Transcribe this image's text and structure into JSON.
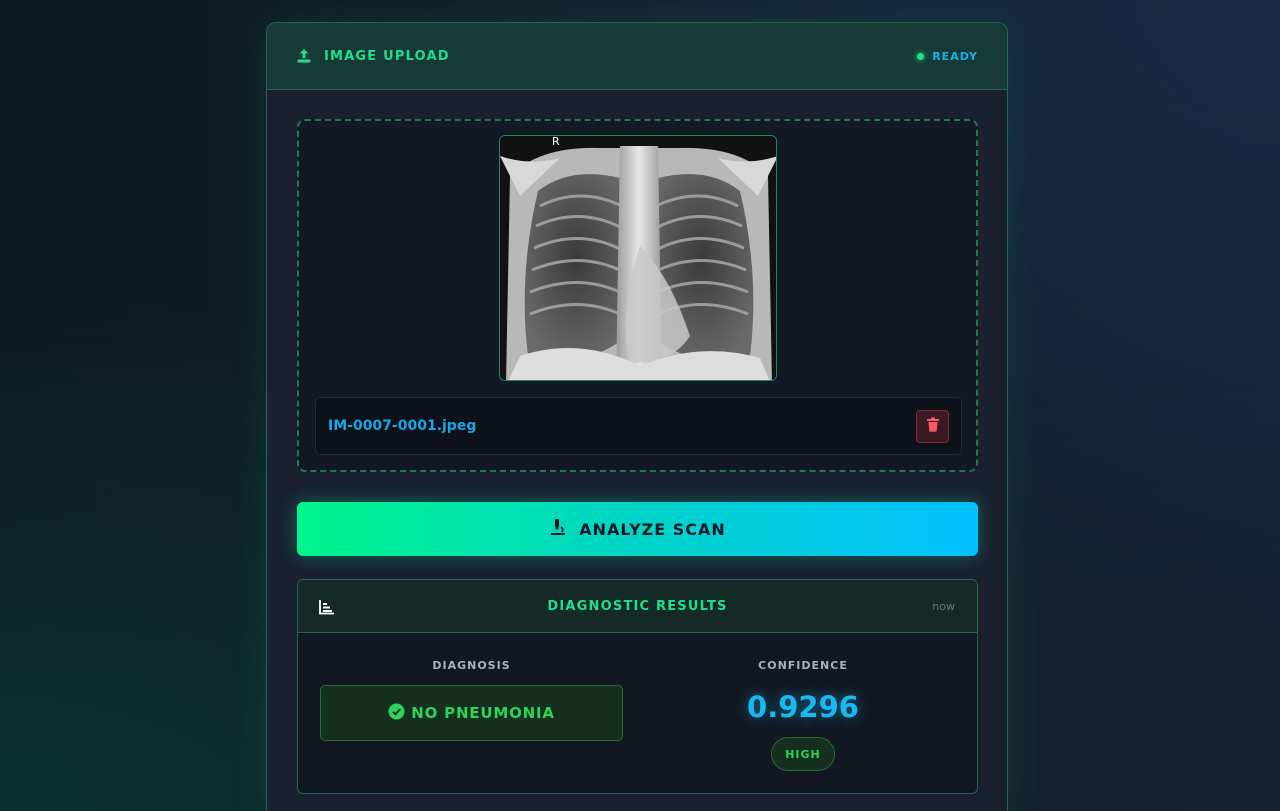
{
  "upload": {
    "title": "IMAGE UPLOAD",
    "status": "READY",
    "file_name": "IM-0007-0001.jpeg",
    "xray_marker": "R"
  },
  "actions": {
    "analyze_label": "ANALYZE SCAN"
  },
  "results": {
    "title": "DIAGNOSTIC RESULTS",
    "timestamp": "now",
    "diagnosis_label": "DIAGNOSIS",
    "diagnosis_value": "NO PNEUMONIA",
    "confidence_label": "CONFIDENCE",
    "confidence_value": "0.9296",
    "confidence_level": "HIGH"
  },
  "colors": {
    "accent_green": "#1ee08a",
    "accent_blue": "#1ab8f0",
    "danger": "#e0505a"
  },
  "icons": {
    "upload": "upload-icon",
    "status": "status-dot-icon",
    "delete": "trash-icon",
    "analyze": "microscope-icon",
    "results": "chart-icon",
    "diagnosis": "check-circle-icon"
  }
}
